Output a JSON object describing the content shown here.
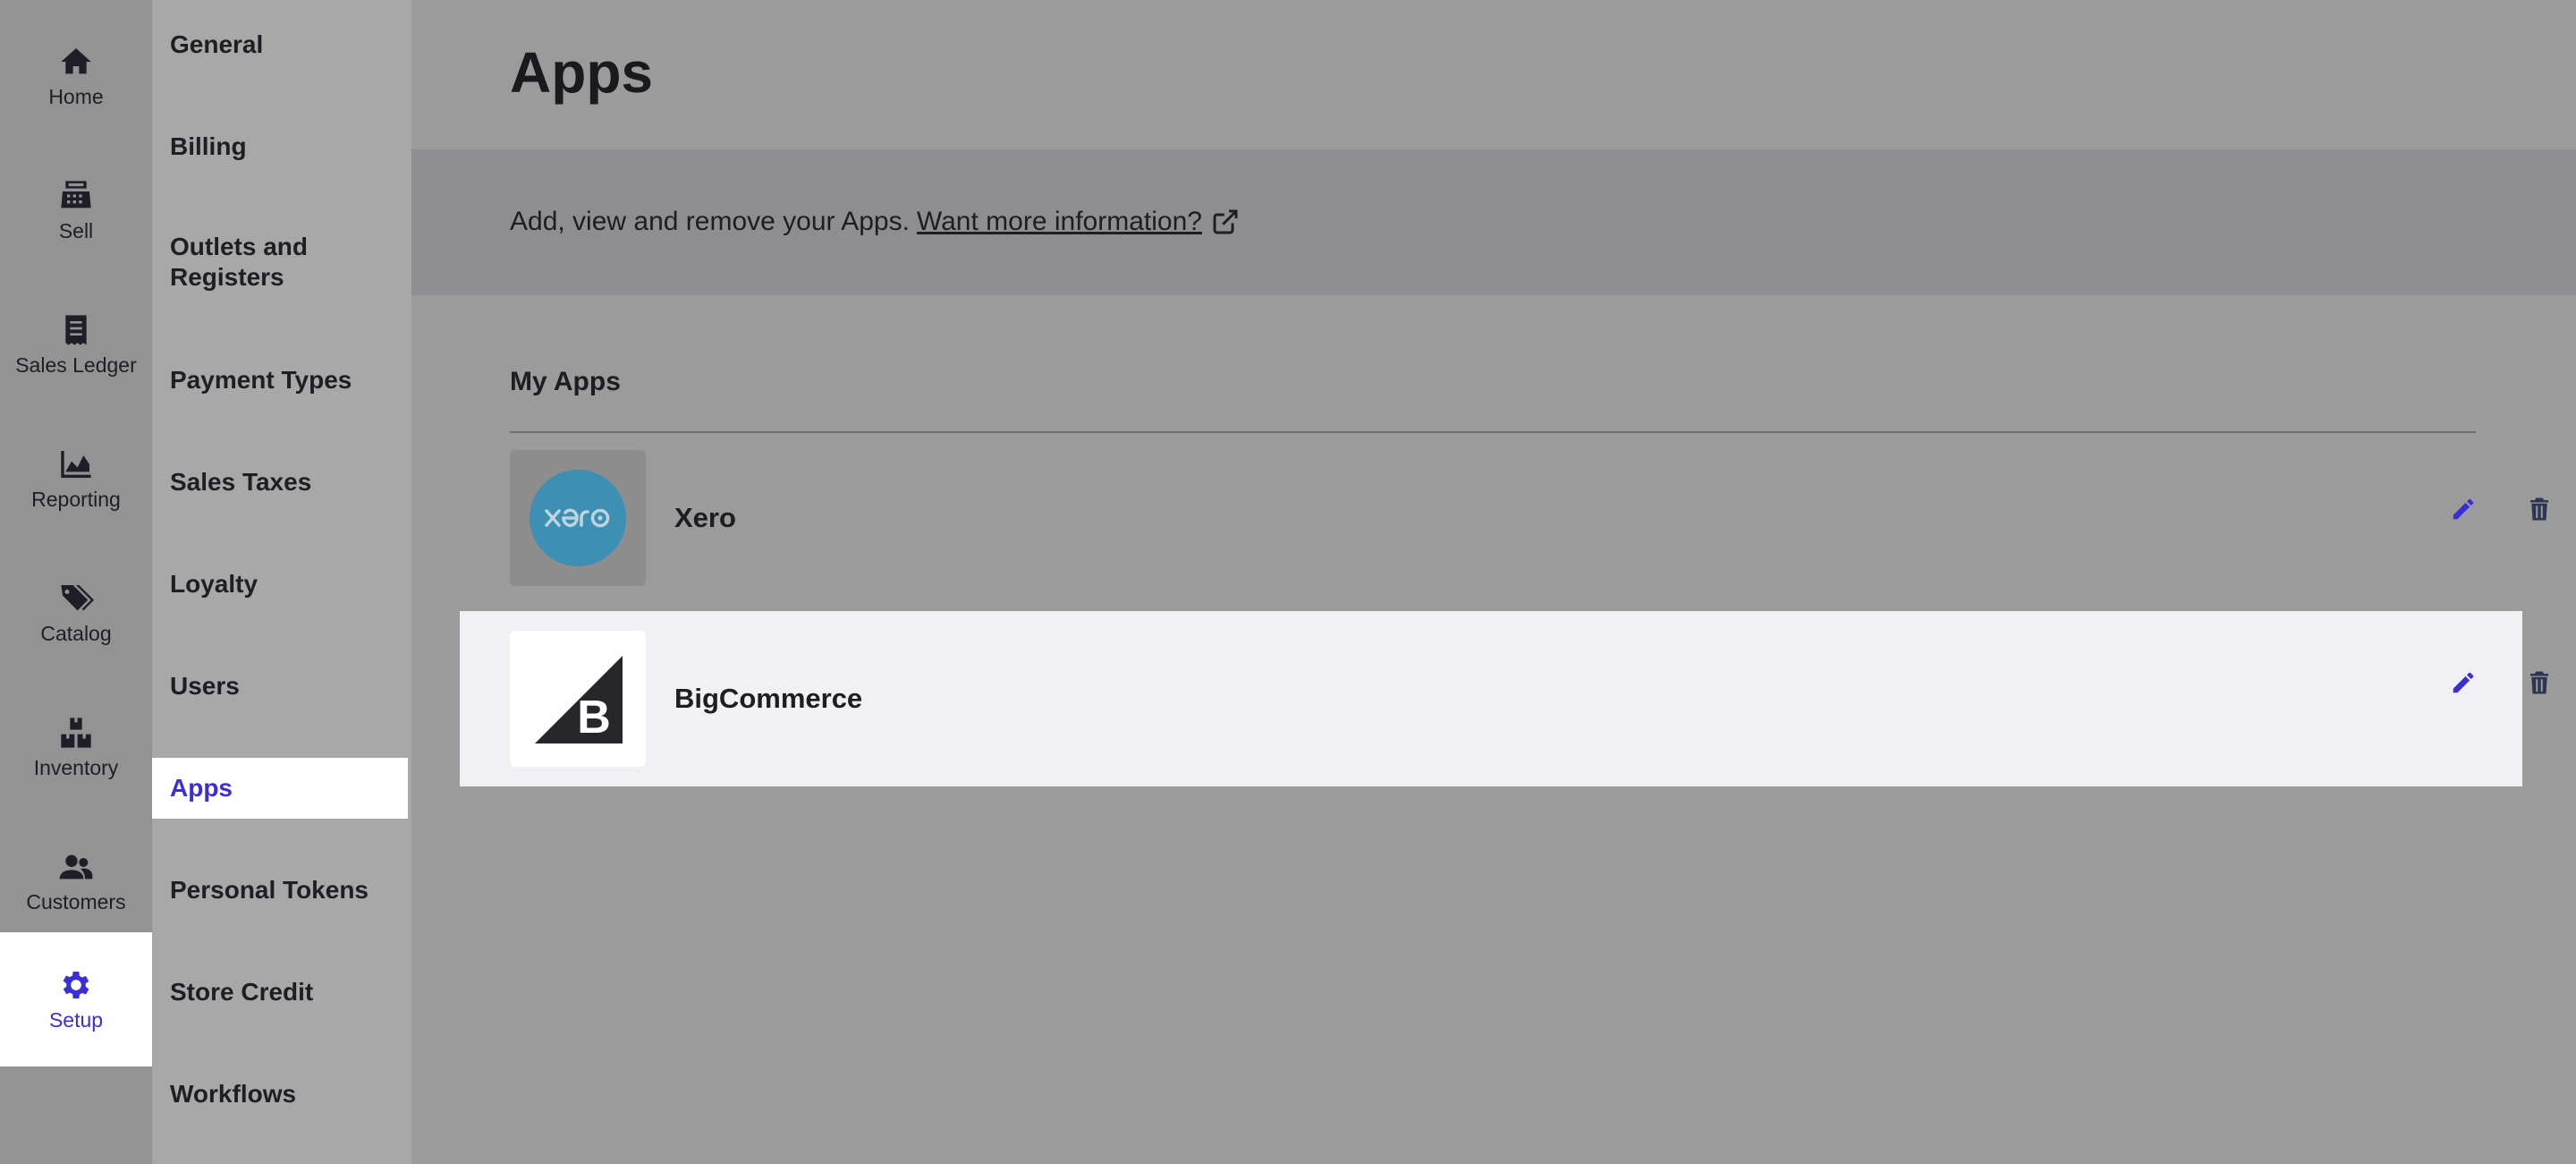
{
  "primary_nav": [
    {
      "label": "Home",
      "icon": "home-icon"
    },
    {
      "label": "Sell",
      "icon": "register-icon"
    },
    {
      "label": "Sales Ledger",
      "icon": "receipt-icon"
    },
    {
      "label": "Reporting",
      "icon": "area-chart-icon"
    },
    {
      "label": "Catalog",
      "icon": "tags-icon"
    },
    {
      "label": "Inventory",
      "icon": "boxes-icon"
    },
    {
      "label": "Customers",
      "icon": "users-icon"
    },
    {
      "label": "Setup",
      "icon": "gear-icon",
      "active": true
    }
  ],
  "secondary_nav": [
    {
      "label": "General"
    },
    {
      "label": "Billing"
    },
    {
      "label": "Outlets and Registers"
    },
    {
      "label": "Payment Types"
    },
    {
      "label": "Sales Taxes"
    },
    {
      "label": "Loyalty"
    },
    {
      "label": "Users"
    },
    {
      "label": "Apps",
      "active": true
    },
    {
      "label": "Personal Tokens"
    },
    {
      "label": "Store Credit"
    },
    {
      "label": "Workflows"
    }
  ],
  "page": {
    "title": "Apps",
    "info_text": "Add, view and remove your Apps.",
    "info_link": "Want more information?"
  },
  "my_apps": {
    "title": "My Apps",
    "apps": [
      {
        "name": "Xero",
        "logo_text": "xero",
        "logo_color": "#3d8fb3"
      },
      {
        "name": "BigCommerce",
        "logo_text": "B",
        "logo_color": "#26262b"
      }
    ]
  },
  "colors": {
    "accent": "#3a2fd6",
    "trash": "#2c3552"
  }
}
